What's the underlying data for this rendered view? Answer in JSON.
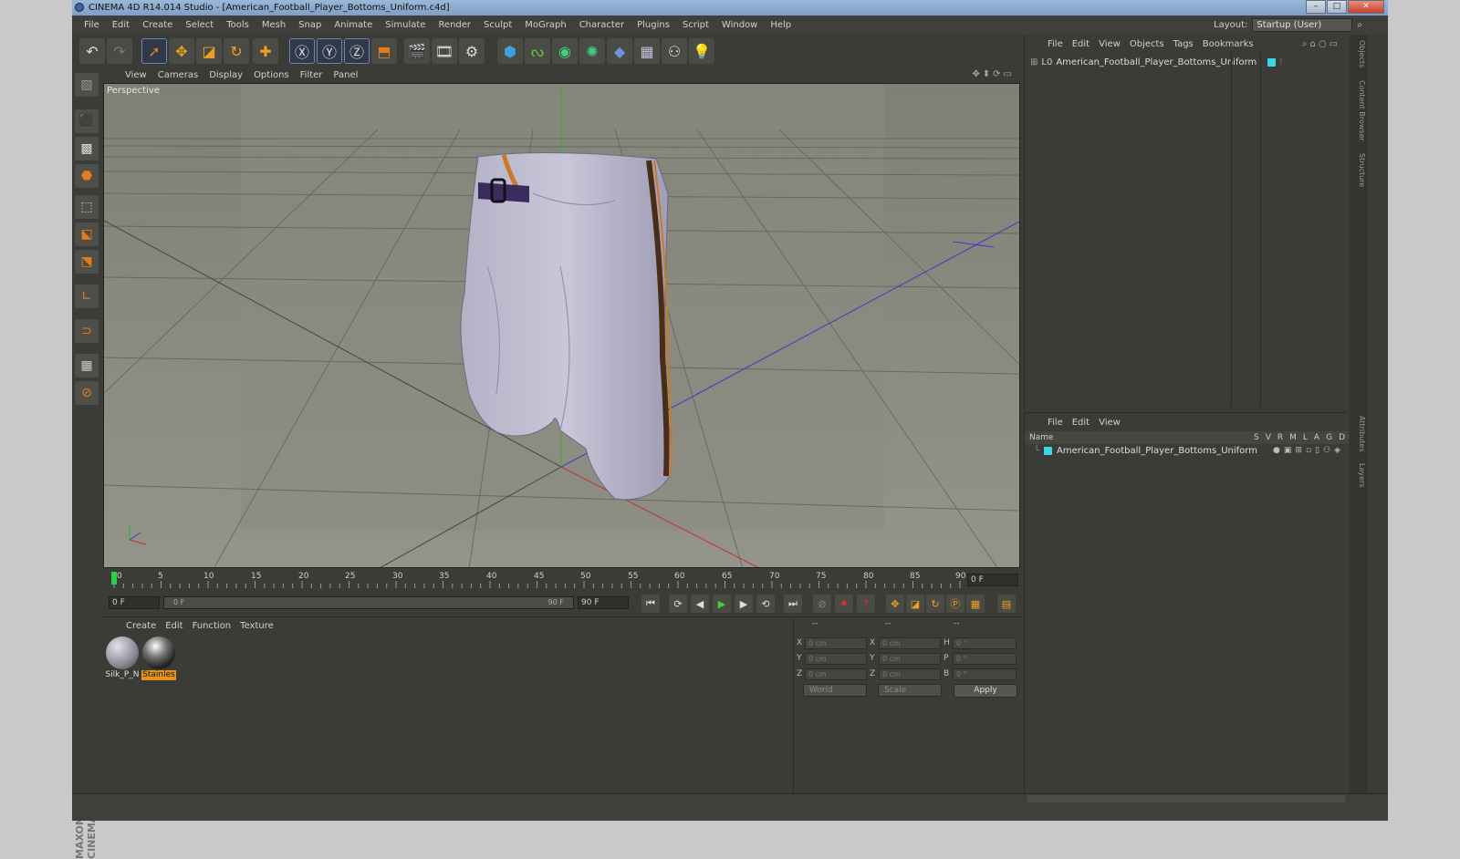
{
  "window": {
    "title": "CINEMA 4D R14.014 Studio - [American_Football_Player_Bottoms_Uniform.c4d]"
  },
  "menu": [
    "File",
    "Edit",
    "Create",
    "Select",
    "Tools",
    "Mesh",
    "Snap",
    "Animate",
    "Simulate",
    "Render",
    "Sculpt",
    "MoGraph",
    "Character",
    "Plugins",
    "Script",
    "Window",
    "Help"
  ],
  "layout": {
    "label": "Layout:",
    "value": "Startup (User)"
  },
  "viewport": {
    "menu": [
      "View",
      "Cameras",
      "Display",
      "Options",
      "Filter",
      "Panel"
    ],
    "label": "Perspective"
  },
  "timeline": {
    "ticks": [
      "0",
      "5",
      "10",
      "15",
      "20",
      "25",
      "30",
      "35",
      "40",
      "45",
      "50",
      "55",
      "60",
      "65",
      "70",
      "75",
      "80",
      "85",
      "90"
    ],
    "current_frame": "0 F",
    "start_frame": "0 F",
    "scrub_start": "0 F",
    "scrub_end": "90 F",
    "end_frame": "90 F"
  },
  "materials": {
    "menu": [
      "Create",
      "Edit",
      "Function",
      "Texture"
    ],
    "items": [
      {
        "name": "Silk_P_N",
        "color": "#8a8a95"
      },
      {
        "name": "Stainles",
        "color": "#444444"
      }
    ]
  },
  "coords": {
    "header": [
      "--",
      "--",
      "--"
    ],
    "rows": [
      {
        "l1": "X",
        "v1": "0 cm",
        "l2": "X",
        "v2": "0 cm",
        "l3": "H",
        "v3": "0 °"
      },
      {
        "l1": "Y",
        "v1": "0 cm",
        "l2": "Y",
        "v2": "0 cm",
        "l3": "P",
        "v3": "0 °"
      },
      {
        "l1": "Z",
        "v1": "0 cm",
        "l2": "Z",
        "v2": "0 cm",
        "l3": "B",
        "v3": "0 °"
      }
    ],
    "mode": "World",
    "scale": "Scale",
    "apply": "Apply"
  },
  "objects": {
    "menu": [
      "File",
      "Edit",
      "View",
      "Objects",
      "Tags",
      "Bookmarks"
    ],
    "item": "American_Football_Player_Bottoms_Uniform"
  },
  "layers": {
    "menu": [
      "File",
      "Edit",
      "View"
    ],
    "name_header": "Name",
    "columns": [
      "S",
      "V",
      "R",
      "M",
      "L",
      "A",
      "G",
      "D"
    ],
    "item": "American_Football_Player_Bottoms_Uniform"
  },
  "sidetabs": [
    "Objects",
    "Content Browser",
    "Structure",
    "Attributes",
    "Layers"
  ],
  "brand": "MAXON CINEMA 4D",
  "colors": {
    "accent": "#e6941c",
    "layer_chip": "#3dd6e8",
    "axis_x": "#c03030",
    "axis_y": "#30b030",
    "axis_z": "#3040c0"
  }
}
